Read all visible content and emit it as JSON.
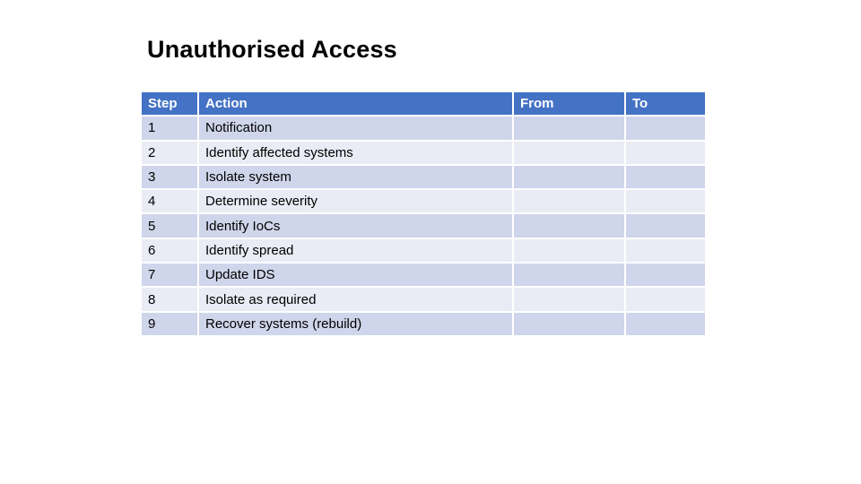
{
  "title": "Unauthorised Access",
  "colors": {
    "header": "#4472C4",
    "row_odd": "#CFD5EA",
    "row_even": "#E9EBF5"
  },
  "table": {
    "headers": [
      "Step",
      "Action",
      "From",
      "To"
    ],
    "rows": [
      {
        "step": "1",
        "action": "Notification",
        "from": "",
        "to": ""
      },
      {
        "step": "2",
        "action": "Identify affected systems",
        "from": "",
        "to": ""
      },
      {
        "step": "3",
        "action": "Isolate system",
        "from": "",
        "to": ""
      },
      {
        "step": "4",
        "action": "Determine severity",
        "from": "",
        "to": ""
      },
      {
        "step": "5",
        "action": "Identify IoCs",
        "from": "",
        "to": ""
      },
      {
        "step": "6",
        "action": "Identify spread",
        "from": "",
        "to": ""
      },
      {
        "step": "7",
        "action": "Update IDS",
        "from": "",
        "to": ""
      },
      {
        "step": "8",
        "action": "Isolate as required",
        "from": "",
        "to": ""
      },
      {
        "step": "9",
        "action": "Recover systems (rebuild)",
        "from": "",
        "to": ""
      }
    ]
  }
}
